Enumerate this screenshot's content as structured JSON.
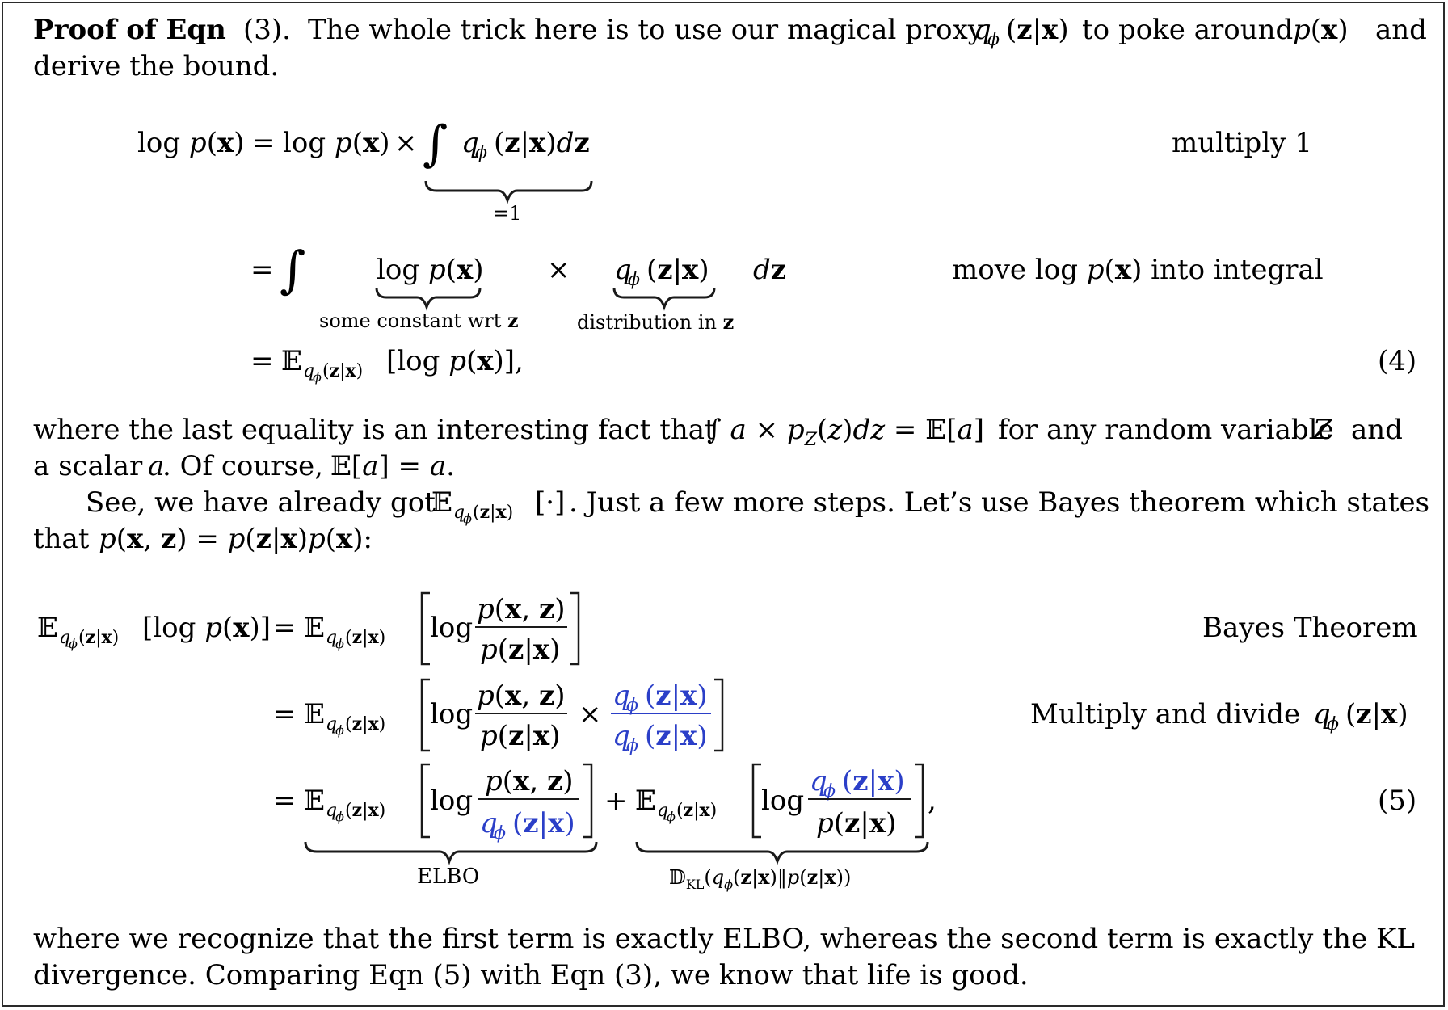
{
  "colors": {
    "accent_blue": "#2b3fc8",
    "text": "#1a1a1a",
    "border": "#2a2a2a"
  },
  "para1": {
    "bold_label": "Proof of Eqn",
    "ref": "(3).",
    "line1_a": "The whole trick here is to use our magical proxy",
    "line1_b": "to poke around",
    "line1_c": "and",
    "line2": "derive the bound."
  },
  "eq4": {
    "log": "log",
    "annot_one": "=1",
    "annot_const": "some constant wrt",
    "annot_dist": "distribution in",
    "z": "z",
    "note_multiply": "multiply 1",
    "note_move_a": "move log",
    "note_move_b": "into integral",
    "number": "(4)"
  },
  "para2": {
    "line1_a": "where the last equality is an interesting fact that",
    "line1_b": "for any random variable",
    "line1_c": "and",
    "line2_a": "a scalar",
    "line2_b": ". Of course,",
    "line3_a": "See, we have already got",
    "line3_b": ". Just a few more steps. Let’s use Bayes theorem which states",
    "line4": "that"
  },
  "eq5": {
    "log": "log",
    "note_bayes": "Bayes Theorem",
    "note_multdiv": "Multiply and divide",
    "label_elbo": "ELBO",
    "label_kl": "KL",
    "number": "(5)"
  },
  "para3": {
    "line1": "where we recognize that the first term is exactly ELBO, whereas the second term is exactly the KL",
    "line2": "divergence. Comparing Eqn (5) with Eqn (3), we know that life is good."
  }
}
